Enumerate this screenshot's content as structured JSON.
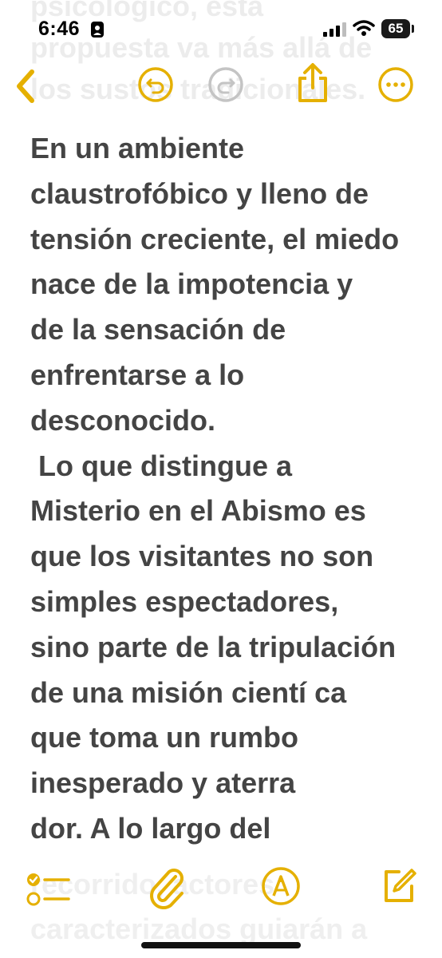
{
  "status_bar": {
    "time": "6:46",
    "battery_level": "65"
  },
  "ghost_text_top": [
    "psicológico, esta",
    "propuesta va más allá de",
    "los sustos tradicionales."
  ],
  "note": {
    "lines": [
      "En un ambiente",
      "claustrofóbico y lleno de",
      "tensión creciente, el miedo",
      "nace de la impotencia y",
      "de la sensación de",
      "enfrentarse a lo",
      "desconocido.",
      " Lo que distingue a",
      "Misterio en el Abismo es",
      "que los visitantes no son",
      "simples espectadores,",
      "sino parte de la tripulación",
      "de una misión cientí ca",
      "que toma un rumbo",
      "inesperado y aterra",
      "dor. A lo largo del"
    ]
  },
  "ghost_text_bottom": [
    "recorrido, actores",
    "caracterizados guiarán a"
  ],
  "icons": {
    "back": "chevron-left-icon",
    "undo": "undo-icon",
    "redo": "redo-icon",
    "share": "share-icon",
    "more": "ellipsis-icon",
    "checklist": "checklist-icon",
    "attach": "paperclip-icon",
    "markup": "markup-pen-icon",
    "compose": "compose-icon"
  },
  "colors": {
    "accent": "#E5B000",
    "disabled": "#C4C4C4",
    "text": "#444444"
  }
}
